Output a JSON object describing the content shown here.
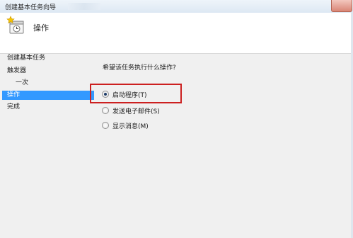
{
  "window": {
    "title": "创建基本任务向导"
  },
  "header": {
    "title": "操作"
  },
  "sidebar": {
    "items": [
      {
        "label": "创建基本任务",
        "selected": false
      },
      {
        "label": "触发器",
        "selected": false
      },
      {
        "label": "一次",
        "selected": false
      },
      {
        "label": "操作",
        "selected": true
      },
      {
        "label": "完成",
        "selected": false
      }
    ]
  },
  "main": {
    "question": "希望该任务执行什么操作?",
    "options": [
      {
        "label": "启动程序(T)",
        "selected": true
      },
      {
        "label": "发送电子邮件(S)",
        "selected": false
      },
      {
        "label": "显示消息(M)",
        "selected": false
      }
    ]
  },
  "colors": {
    "selection": "#3399ff",
    "highlight_box": "#cc2020"
  }
}
